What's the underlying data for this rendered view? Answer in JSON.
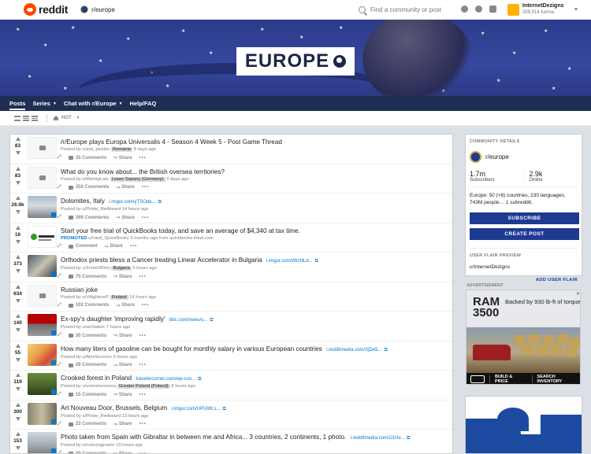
{
  "header": {
    "brand": "reddit",
    "current_sub": "r/europe",
    "search_placeholder": "Find a community or post",
    "username": "InternetDezigns",
    "karma": "359,914 karma"
  },
  "banner": {
    "title": "EUROPE"
  },
  "subnav": {
    "items": [
      {
        "label": "Posts",
        "dropdown": false,
        "active": true
      },
      {
        "label": "Series",
        "dropdown": true,
        "active": false
      },
      {
        "label": "Chat with r/Europe",
        "dropdown": true,
        "active": false
      },
      {
        "label": "Help/FAQ",
        "dropdown": false,
        "active": false
      }
    ]
  },
  "viewbar": {
    "sort": "HOT"
  },
  "posts": [
    {
      "score": "83",
      "title": "/r/Europe plays Europa Universalis 4 - Season 4 Week 5 - Post Game Thread",
      "domain": "",
      "meta_pre": "Posted by u/ass_pickles",
      "flair": "Romania",
      "meta_post": "8 days ago",
      "comments": "35 Comments",
      "thumb": "text"
    },
    {
      "score": "83",
      "title": "What do you know about... the British oversea territories?",
      "domain": "",
      "meta_pre": "Posted by u/MarktpLatz",
      "flair": "Lower Saxony (Germany)",
      "meta_post": "2 days ago",
      "comments": "250 Comments",
      "thumb": "text"
    },
    {
      "score": "26.9k",
      "title": "Dolomites, Italy",
      "domain": "i.imgur.com/yTSOde...",
      "meta_pre": "Posted by u/Pirate_Redbeard 14 hours ago",
      "flair": "",
      "meta_post": "",
      "comments": "399 Comments",
      "thumb": "mountains"
    },
    {
      "score": "16",
      "title": "Start your free trial of QuickBooks today, and save an average of $4,340 at tax time.",
      "domain": "",
      "promoted": "PROMOTED",
      "meta_pre": "u/Intuit_QuickBooks 3 months ago from quickbooks.intuit.com",
      "flair": "",
      "meta_post": "",
      "comments": "Comment",
      "thumb": "quickbooks"
    },
    {
      "score": "373",
      "title": "Orthodox priests bless a Cancer treating Linear Accelerator in Bulgaria",
      "domain": "i.imgur.com/tWcNLd...",
      "meta_pre": "Posted by u/ZmeiOtPirin",
      "flair": "Bulgaria",
      "meta_post": "5 hours ago",
      "comments": "75 Comments",
      "thumb": "priests"
    },
    {
      "score": "634",
      "title": "Russian joke",
      "domain": "",
      "meta_pre": "Posted by u/VittgNeveP",
      "flair": "Finland",
      "meta_post": "14 hours ago",
      "comments": "102 Comments",
      "thumb": "text"
    },
    {
      "score": "140",
      "title": "Ex-spy's daughter 'improving rapidly'",
      "domain": "bbc.com/news/u...",
      "meta_pre": "Posted by u/seXiabox 7 hours ago",
      "flair": "",
      "meta_post": "",
      "comments": "30 Comments",
      "thumb": "news"
    },
    {
      "score": "55",
      "title": "How many liters of gasoline can be bought for monthly salary in various European countries",
      "domain": "i.redditmedia.com/XjDe5...",
      "meta_pre": "Posted by u/AlexSuvorov 3 hours ago",
      "flair": "",
      "meta_post": "",
      "comments": "29 Comments",
      "thumb": "map"
    },
    {
      "score": "119",
      "title": "Crooked forest in Poland",
      "domain": "travelercorner.com/wp-con...",
      "meta_pre": "Posted by u/uneretsevenos",
      "flair": "Greater Poland (Poland)",
      "meta_post": "8 hours ago",
      "comments": "15 Comments",
      "thumb": "forest"
    },
    {
      "score": "300",
      "title": "Art Nouveau Door, Brussels, Belgium",
      "domain": "i.imgur.com/UPUWLs...",
      "meta_pre": "Posted by u/Pirate_Redbeard 13 hours ago",
      "flair": "",
      "meta_post": "",
      "comments": "23 Comments",
      "thumb": "door"
    },
    {
      "score": "153",
      "title": "Photo taken from Spain with Gibraltar in between me and Africa... 3 countries, 2 continents, 1 photo.",
      "domain": "i.redditmedia.com/iJ1Hv...",
      "meta_pre": "Posted by u/notusingname 10 hours ago",
      "flair": "",
      "meta_post": "",
      "comments": "30 Comments",
      "thumb": "gibraltar"
    }
  ],
  "actions": {
    "share": "Share",
    "more": "•••"
  },
  "sidebar": {
    "label": "COMMUNITY DETAILS",
    "name": "r/europe",
    "subscribers": "1.7m",
    "subscribers_label": "Subscribers",
    "online": "2.9k",
    "online_label": "Online",
    "description": "Europe: 50 (+6) countries, 230 languages, 743M people… 1 subreddit.",
    "subscribe": "SUBSCRIBE",
    "create_post": "CREATE POST",
    "flair_label": "USER FLAIR PREVIEW",
    "flair_user": "u/InternetDezigns",
    "add_flair": "ADD USER FLAIR"
  },
  "ad": {
    "label": "ADVERTISEMENT",
    "brand_line1": "RAM",
    "brand_line2": "3500",
    "headline": "Backed by 930 lb-ft of torque",
    "cta1": "BUILD & PRICE",
    "cta2": "SEARCH INVENTORY"
  }
}
